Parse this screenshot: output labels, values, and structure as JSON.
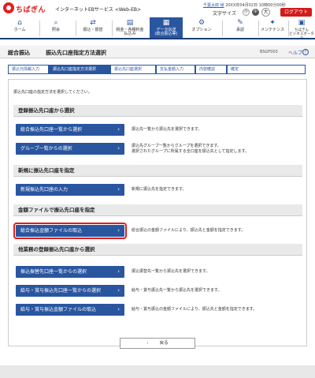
{
  "header": {
    "logo": "ちばぎん",
    "service": "インターネットEBサービス <Web-EB>",
    "user_name": "千葉太郎 様",
    "login_time": "20XX年04月02日 10時00分00秒",
    "text_size_label": "文字サイズ",
    "size_small": "小",
    "size_medium": "中",
    "size_large": "大",
    "logout": "ログアウト"
  },
  "nav": [
    {
      "label": "ホーム",
      "icon": "home-icon"
    },
    {
      "label": "照会",
      "icon": "magnifier-icon"
    },
    {
      "label": "振込・振替",
      "icon": "transfer-icon"
    },
    {
      "label": "税金・各種料金\n払込み",
      "icon": "receipt-icon"
    },
    {
      "label": "データ伝送\n(総合振込等)",
      "icon": "data-transfer-icon"
    },
    {
      "label": "オプション",
      "icon": "gear-icon"
    },
    {
      "label": "承認",
      "icon": "approve-icon"
    },
    {
      "label": "メンテナンス",
      "icon": "wrench-icon"
    },
    {
      "label": "ちばぎん\nビジネスポータル",
      "icon": "portal-icon"
    }
  ],
  "title": {
    "main": "総合振込",
    "sub": "振込先口座指定方法選択",
    "code": "BSGF003",
    "help": "ヘルプ"
  },
  "steps": [
    "振込元情報入力",
    "振込先口座指定方法選択",
    "振込先口座選択",
    "支払金額入力",
    "内容確認",
    "確定"
  ],
  "instruction": "振込先口座の指定方法を選択してください。",
  "sections": [
    {
      "heading": "登録振込先口座から選択",
      "items": [
        {
          "button": "総合振込先口座一覧から選択",
          "desc": "振込先一覧から振込先を選択できます。"
        },
        {
          "button": "グループ一覧からの選択",
          "desc": "振込先グループ一覧からグループを選択できます。\n選択されたグループに所属する全口座を振込先として指定します。"
        }
      ]
    },
    {
      "heading": "新規に振込先口座を指定",
      "items": [
        {
          "button": "新規振込先口座の入力",
          "desc": "新規に振込先を指定できます。"
        }
      ]
    },
    {
      "heading": "金額ファイルで振込先口座を指定",
      "items": [
        {
          "button": "総合振込金額ファイルの取込",
          "desc": "総合振込の金額ファイルにより、振込先と金額を指定できます。"
        }
      ]
    },
    {
      "heading": "他業務の登録振込先口座から選択",
      "items": [
        {
          "button": "振込振替先口座一覧からの選択",
          "desc": "振込振替先一覧から振込先を選択できます。"
        },
        {
          "button": "給与・賞与振込先口座一覧からの選択",
          "desc": "給与・賞与振込先一覧から振込先を選択できます。"
        },
        {
          "button": "給与・賞与振込金額ファイルの取込",
          "desc": "給与・賞与振込の金額ファイルにより、振込先と金額を指定できます。"
        }
      ]
    }
  ],
  "back": "戻る"
}
